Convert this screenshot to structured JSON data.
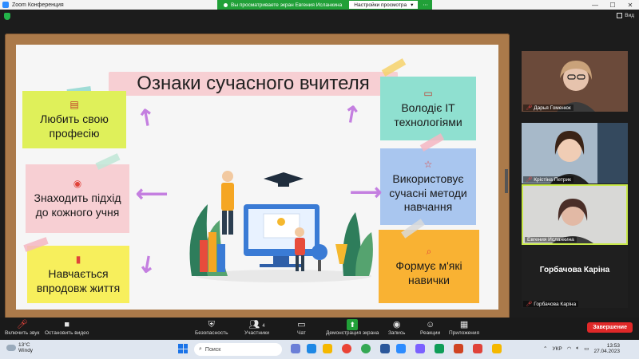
{
  "window": {
    "title": "Zoom Конференция",
    "controls": [
      "—",
      "☐",
      "✕"
    ]
  },
  "share_banner": {
    "viewing_text": "Вы просматриваете экран Евгения Исланкина",
    "view_settings_label": "Настройки просмотра",
    "dropdown_glyph": "▾",
    "more_glyph": "⋯"
  },
  "view_button": {
    "label": "Вид"
  },
  "slide": {
    "title": "Ознаки сучасного вчителя",
    "notes": {
      "love_profession": "Любить свою професію",
      "approach": "Знаходить підхід до кожного учня",
      "lifelong": "Навчається впродовж життя",
      "it": "Володіє IT технологіями",
      "methods": "Використовує сучасні методи навчання",
      "soft_skills": "Формує м'які навички"
    },
    "colors": {
      "green_note": "#dff05a",
      "pink_note": "#f7cfd3",
      "yellow_note": "#f7ef5c",
      "teal_note": "#8fe0d0",
      "blue_note": "#a9c6ef",
      "orange_note": "#f9b233",
      "arrow": "#c47fe0"
    }
  },
  "participants": [
    {
      "name": "Дарья Гоменюк",
      "muted": true
    },
    {
      "name": "Крістіна Петрик",
      "muted": true
    },
    {
      "name": "Евгения Исланкина",
      "muted": false
    },
    {
      "name": "Горбачова Каріна",
      "display": "Горбачова  Каріна",
      "muted": true
    }
  ],
  "toolbar": {
    "mute": "Включить звук",
    "video": "Остановить видео",
    "security": "Безопасность",
    "participants": "Участники",
    "participants_count": "4",
    "chat": "Чат",
    "share": "Демонстрация экрана",
    "record": "Запись",
    "reactions": "Реакции",
    "apps": "Приложения",
    "end": "Завершение"
  },
  "taskbar": {
    "temperature": "13°C",
    "weather": "Windy",
    "search_placeholder": "Поиск",
    "language": "УКР",
    "time": "13:53",
    "date": "27.04.2023"
  }
}
